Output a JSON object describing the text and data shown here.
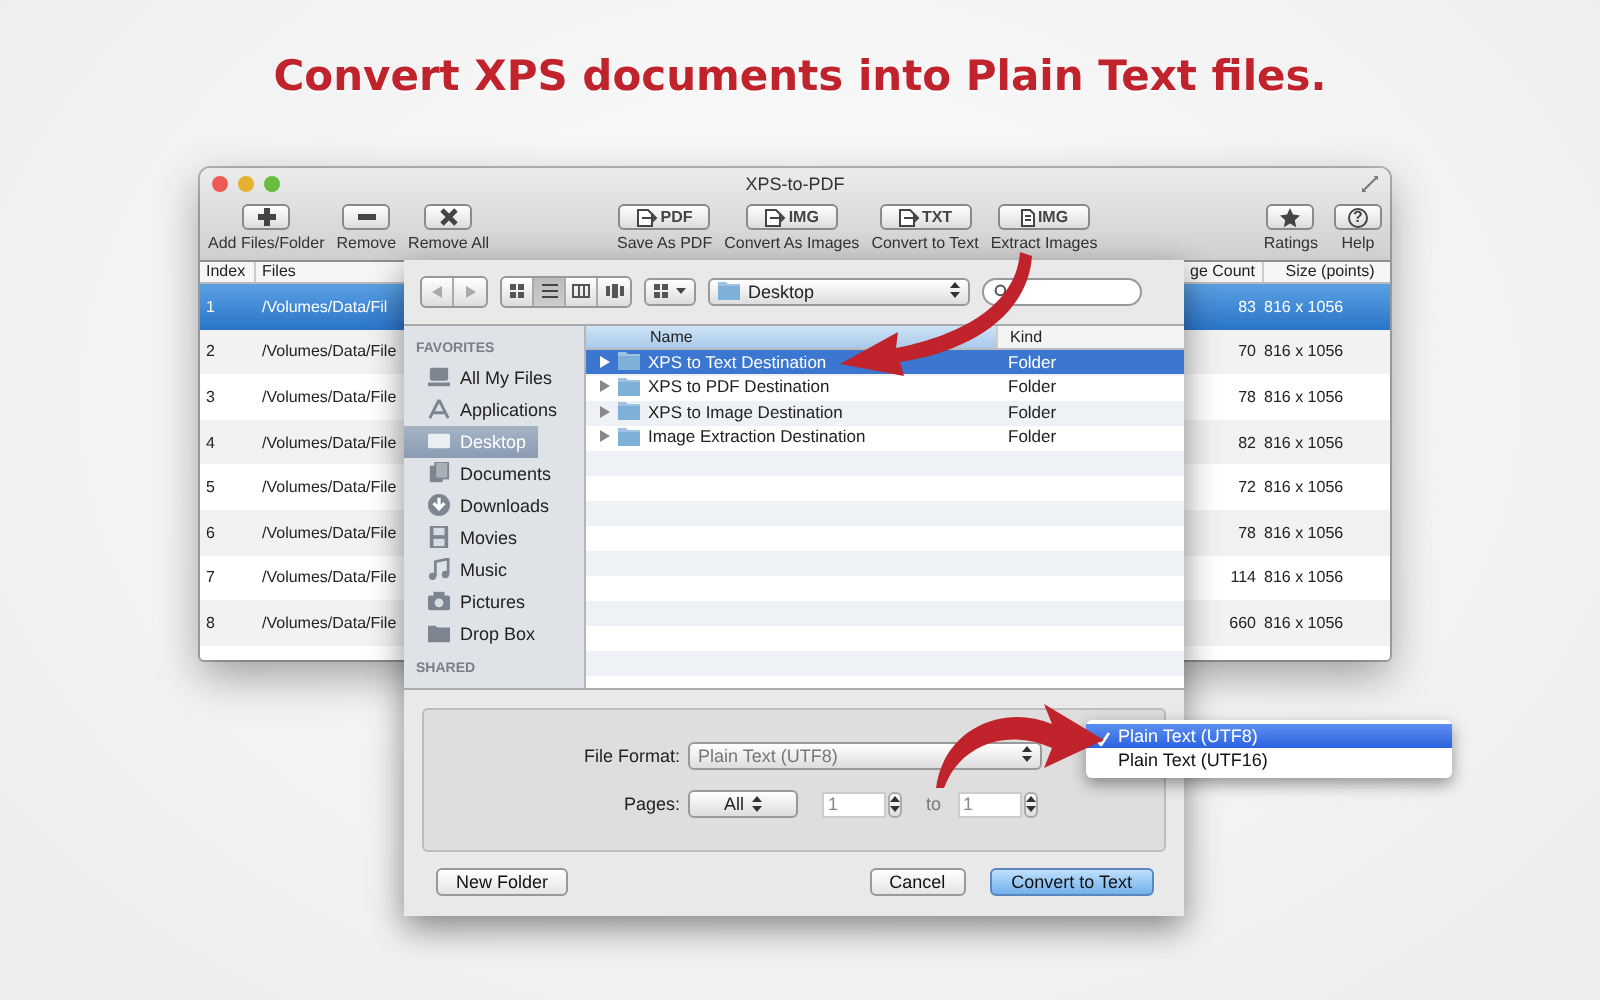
{
  "headline": "Convert XPS documents into Plain Text files.",
  "window": {
    "title": "XPS-to-PDF"
  },
  "toolbar": [
    {
      "label": "Add Files/Folder",
      "kind": "plus"
    },
    {
      "label": "Remove",
      "kind": "minus"
    },
    {
      "label": "Remove All",
      "kind": "cross"
    },
    {
      "label": "Save As PDF",
      "kind": "doc",
      "icon_text": "PDF"
    },
    {
      "label": "Convert As Images",
      "kind": "doc",
      "icon_text": "IMG"
    },
    {
      "label": "Convert to Text",
      "kind": "doc",
      "icon_text": "TXT"
    },
    {
      "label": "Extract Images",
      "kind": "page",
      "icon_text": "IMG"
    },
    {
      "label": "Ratings",
      "kind": "star"
    },
    {
      "label": "Help",
      "kind": "help",
      "glyph": "?"
    }
  ],
  "table": {
    "columns": [
      "Index",
      "Files",
      "ge Count",
      "Size (points)"
    ],
    "rows": [
      {
        "index": "1",
        "file": "/Volumes/Data/Fil",
        "page_count": "83",
        "size": "816 x 1056",
        "selected": true
      },
      {
        "index": "2",
        "file": "/Volumes/Data/File",
        "page_count": "70",
        "size": "816 x 1056",
        "selected": false
      },
      {
        "index": "3",
        "file": "/Volumes/Data/File",
        "page_count": "78",
        "size": "816 x 1056",
        "selected": false
      },
      {
        "index": "4",
        "file": "/Volumes/Data/File",
        "page_count": "82",
        "size": "816 x 1056",
        "selected": false
      },
      {
        "index": "5",
        "file": "/Volumes/Data/File",
        "page_count": "72",
        "size": "816 x 1056",
        "selected": false
      },
      {
        "index": "6",
        "file": "/Volumes/Data/File",
        "page_count": "78",
        "size": "816 x 1056",
        "selected": false
      },
      {
        "index": "7",
        "file": "/Volumes/Data/File",
        "page_count": "114",
        "size": "816 x 1056",
        "selected": false
      },
      {
        "index": "8",
        "file": "/Volumes/Data/File",
        "page_count": "660",
        "size": "816 x 1056",
        "selected": false
      }
    ]
  },
  "dialog": {
    "view_buttons": [
      {
        "kind": "icons",
        "selected": false
      },
      {
        "kind": "list",
        "selected": true
      },
      {
        "kind": "columns",
        "selected": false
      },
      {
        "kind": "coverflow",
        "selected": false
      }
    ],
    "location": "Desktop",
    "sidebar": [
      {
        "heading": "FAVORITES",
        "items": [
          {
            "label": "All My Files",
            "kind": "files",
            "selected": false
          },
          {
            "label": "Applications",
            "kind": "apps",
            "selected": false
          },
          {
            "label": "Desktop",
            "kind": "desktop",
            "selected": true
          },
          {
            "label": "Documents",
            "kind": "documents",
            "selected": false
          },
          {
            "label": "Downloads",
            "kind": "downloads",
            "selected": false
          },
          {
            "label": "Movies",
            "kind": "movies",
            "selected": false
          },
          {
            "label": "Music",
            "kind": "music",
            "selected": false
          },
          {
            "label": "Pictures",
            "kind": "pictures",
            "selected": false
          },
          {
            "label": "Drop Box",
            "kind": "folder",
            "selected": false
          }
        ]
      },
      {
        "heading": "SHARED"
      }
    ],
    "file_list": {
      "columns": [
        "Name",
        "Kind"
      ],
      "rows": [
        {
          "name": "XPS to Text Destination",
          "kind_label": "Folder",
          "expanded": false,
          "selected": true
        },
        {
          "name": "XPS to PDF Destination",
          "kind_label": "Folder",
          "expanded": false,
          "selected": false
        },
        {
          "name": "XPS to Image Destination",
          "kind_label": "Folder",
          "expanded": false,
          "selected": false
        },
        {
          "name": "Image Extraction Destination",
          "kind_label": "Folder",
          "expanded": false,
          "selected": false
        }
      ]
    },
    "options": {
      "file_format_label": "File Format:",
      "file_format": "Plain Text (UTF8)",
      "pages_label": "Pages:",
      "pages": "All",
      "from": "1",
      "to_label": "to",
      "to": "1"
    },
    "buttons": [
      {
        "label": "New Folder",
        "kind": "plain"
      },
      {
        "label": "Cancel",
        "kind": "plain"
      },
      {
        "label": "Convert to Text",
        "kind": "default"
      }
    ]
  },
  "menu": [
    {
      "label": "Plain Text (UTF8)",
      "checked": true,
      "selected": true
    },
    {
      "label": "Plain Text (UTF16)",
      "checked": false,
      "selected": false
    }
  ]
}
